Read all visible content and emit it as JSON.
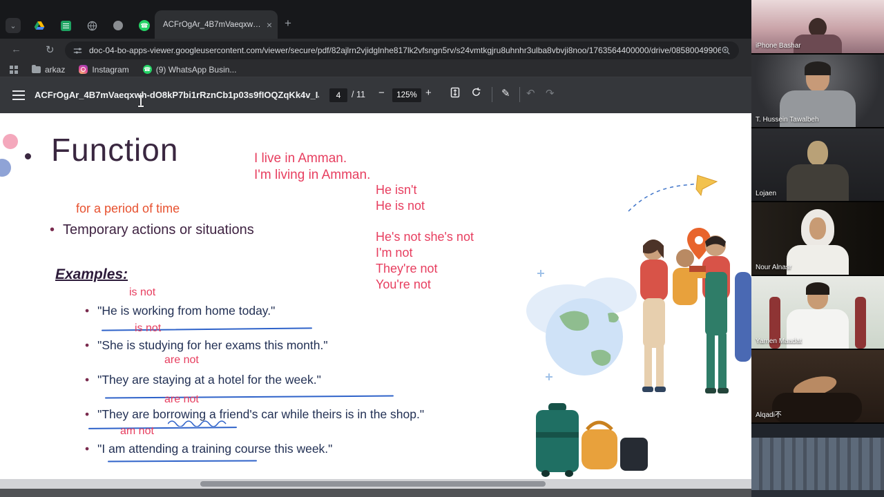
{
  "browser": {
    "tab": {
      "title": "ACFrOgAr_4B7mVaeqxwh-dO8...",
      "close_label": "×",
      "new_tab_label": "+"
    },
    "nav": {
      "back": "←",
      "reload": "↻"
    },
    "address": {
      "url": "doc-04-bo-apps-viewer.googleusercontent.com/viewer/secure/pdf/82ajlrn2vjidglnhe817lk2vfsngn5rv/s24vmtkgjru8uhnhr3ulba8vbvji8noo/1763564400000/drive/08580049906717370..."
    },
    "bookmarks": [
      {
        "label": "arkaz"
      },
      {
        "label": "Instagram"
      },
      {
        "label": "(9) WhatsApp Busin..."
      }
    ]
  },
  "pdf": {
    "filename": "ACFrOgAr_4B7mVaeqxwh-dO8kP7bi1rRznCb1p03s9fIOQZqKk4v_IJknMYB0yI8IJ...",
    "page_current": "4",
    "page_total": "/ 11",
    "zoom_out": "−",
    "zoom_level": "125%",
    "zoom_in": "+",
    "undo": "↶",
    "redo": "↷",
    "annotate": "✎"
  },
  "slide": {
    "title": "Function",
    "bullet_glyph": "•",
    "intro_line1": "I live in Amman.",
    "intro_line2": "I'm living in Amman.",
    "isnt_line1": "He isn't",
    "isnt_line2": "He is not",
    "period_note": "for a period of time",
    "main_point": "Temporary actions or situations",
    "contraction1": "He's not she's not",
    "contraction2": "I'm not",
    "contraction3": "They're not",
    "contraction4": "You're not",
    "examples_heading": "Examples:",
    "sentences": [
      {
        "annotation": "is not",
        "text": "\"He is working from home today.\""
      },
      {
        "annotation": "is not",
        "text": "\"She is studying for her exams this month.\""
      },
      {
        "annotation": "are not",
        "text": "\"They are staying at a hotel for the week.\""
      },
      {
        "annotation": "are not",
        "text": "\"They are borrowing a friend's car while theirs is in the shop.\""
      },
      {
        "annotation": "am not",
        "text": "\"I am attending a training course this week.\""
      }
    ],
    "accent_colors": {
      "red_text": "#e73e5f",
      "orange_text": "#e7512f",
      "title": "#3a2740",
      "body": "#223054",
      "ink_line": "#2e62c9"
    }
  },
  "participants": [
    {
      "name": "iPhone Bashar"
    },
    {
      "name": "T. Hussein Tawalbeh"
    },
    {
      "name": "Lojaen"
    },
    {
      "name": "Nour Alnasr"
    },
    {
      "name": "Yamen Maadat"
    },
    {
      "name": "Alqadi不"
    },
    {
      "name": ""
    }
  ]
}
